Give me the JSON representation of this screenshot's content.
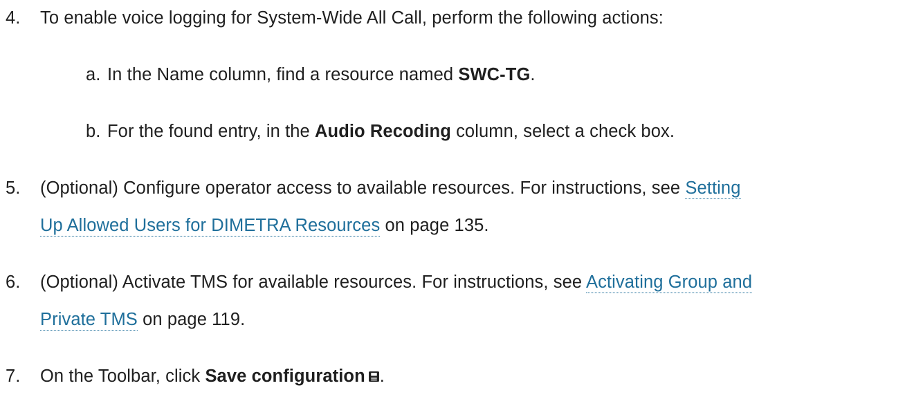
{
  "steps": [
    {
      "num": "4.",
      "pre": "To enable voice logging for System-Wide All Call, perform the following actions:"
    },
    {
      "num": "5.",
      "pre": "(Optional) Configure operator access to available resources. For instructions, see ",
      "link_line1": "Setting",
      "link_line2": "Up Allowed Users for DIMETRA Resources",
      "post": " on page 135."
    },
    {
      "num": "6.",
      "pre": "(Optional) Activate TMS for available resources. For instructions, see ",
      "link_line1": "Activating Group and",
      "link_line2": "Private TMS",
      "post": " on page 119."
    },
    {
      "num": "7.",
      "pre": "On the Toolbar, click ",
      "bold": "Save configuration",
      "post": "."
    }
  ],
  "substeps": [
    {
      "num": "a.",
      "pre": "In the Name column, find a resource named ",
      "bold": "SWC-TG",
      "post": "."
    },
    {
      "num": "b.",
      "pre": "For the found entry, in the ",
      "bold": "Audio Recoding",
      "post": " column, select a check box."
    }
  ],
  "icons": {
    "save": "save-disk-icon"
  }
}
